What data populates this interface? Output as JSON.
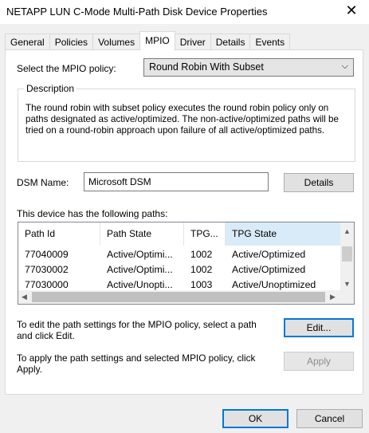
{
  "window": {
    "title": "NETAPP LUN C-Mode  Multi-Path Disk Device Properties",
    "close_glyph": "✕"
  },
  "tabs": [
    {
      "label": "General"
    },
    {
      "label": "Policies"
    },
    {
      "label": "Volumes"
    },
    {
      "label": "MPIO"
    },
    {
      "label": "Driver"
    },
    {
      "label": "Details"
    },
    {
      "label": "Events"
    }
  ],
  "mpio": {
    "policy_label": "Select the MPIO policy:",
    "policy_value": "Round Robin With Subset",
    "description_legend": "Description",
    "description_text": "The round robin with subset policy executes the round robin policy only on paths designated as active/optimized.  The non-active/optimized paths will be tried on a round-robin approach upon failure of all active/optimized paths.",
    "dsm_label": "DSM Name:",
    "dsm_value": "Microsoft DSM",
    "details_button": "Details",
    "paths_label": "This device has the following paths:",
    "columns": [
      "Path Id",
      "Path State",
      "TPG...",
      "TPG State"
    ],
    "rows": [
      [
        "77040009",
        "Active/Optimi...",
        "1002",
        "Active/Optimized"
      ],
      [
        "77030002",
        "Active/Optimi...",
        "1002",
        "Active/Optimized"
      ],
      [
        "77030000",
        "Active/Unopti...",
        "1003",
        "Active/Unoptimized"
      ]
    ],
    "edit_hint": "To edit the path settings for the MPIO policy, select a path and click Edit.",
    "edit_button": "Edit...",
    "apply_hint": "To apply the path settings and selected MPIO policy, click Apply.",
    "apply_button": "Apply"
  },
  "footer": {
    "ok_button": "OK",
    "cancel_button": "Cancel"
  },
  "icons": {
    "chevron_down": "⌵",
    "arrow_up": "▲",
    "arrow_down": "▼",
    "arrow_left": "◀",
    "arrow_right": "▶"
  },
  "colors": {
    "accent": "#0078d7",
    "header_highlight": "#d9ebf9"
  }
}
